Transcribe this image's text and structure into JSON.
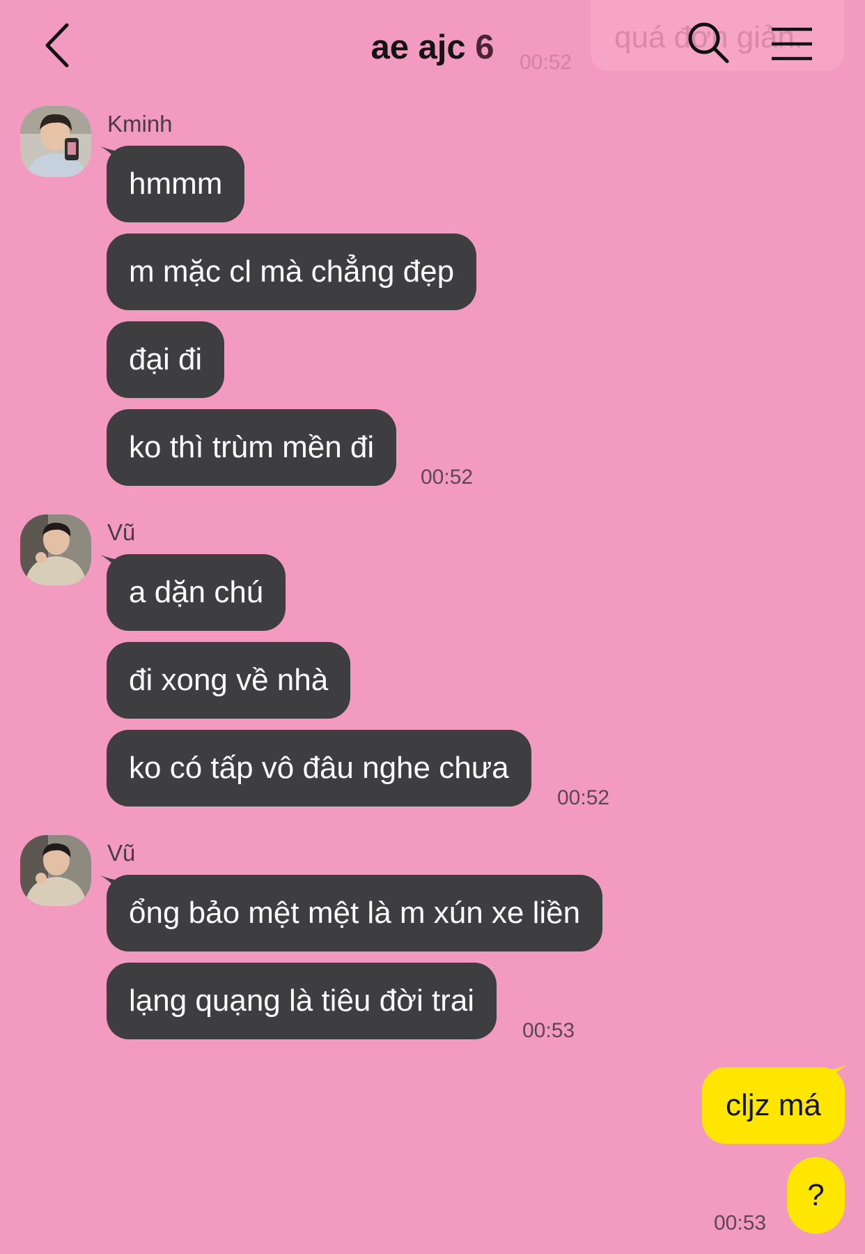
{
  "header": {
    "title": "ae ajc",
    "member_count": "6",
    "ghost_message": "quá đơn giản.",
    "ghost_time": "00:52"
  },
  "colors": {
    "background": "#f39ac0",
    "incoming_bubble": "#3e3e40",
    "outgoing_bubble": "#fee600"
  },
  "icons": [
    "back-arrow-icon",
    "search-icon",
    "menu-icon"
  ],
  "groups": [
    {
      "sender": "Kminh",
      "messages": [
        "hmmm",
        "m mặc cl mà chẳng đẹp",
        "đại đi",
        "ko thì trùm mền đi"
      ],
      "time": "00:52"
    },
    {
      "sender": "Vũ",
      "messages": [
        "a dặn chú",
        "đi xong về nhà",
        "ko có tấp vô đâu nghe chưa"
      ],
      "time": "00:52"
    },
    {
      "sender": "Vũ",
      "messages": [
        "ổng bảo mệt mệt là m xún xe liền",
        "lạng quạng là tiêu đời trai"
      ],
      "time": "00:53"
    }
  ],
  "outgoing": {
    "messages": [
      "cljz má",
      "?"
    ],
    "time": "00:53"
  }
}
